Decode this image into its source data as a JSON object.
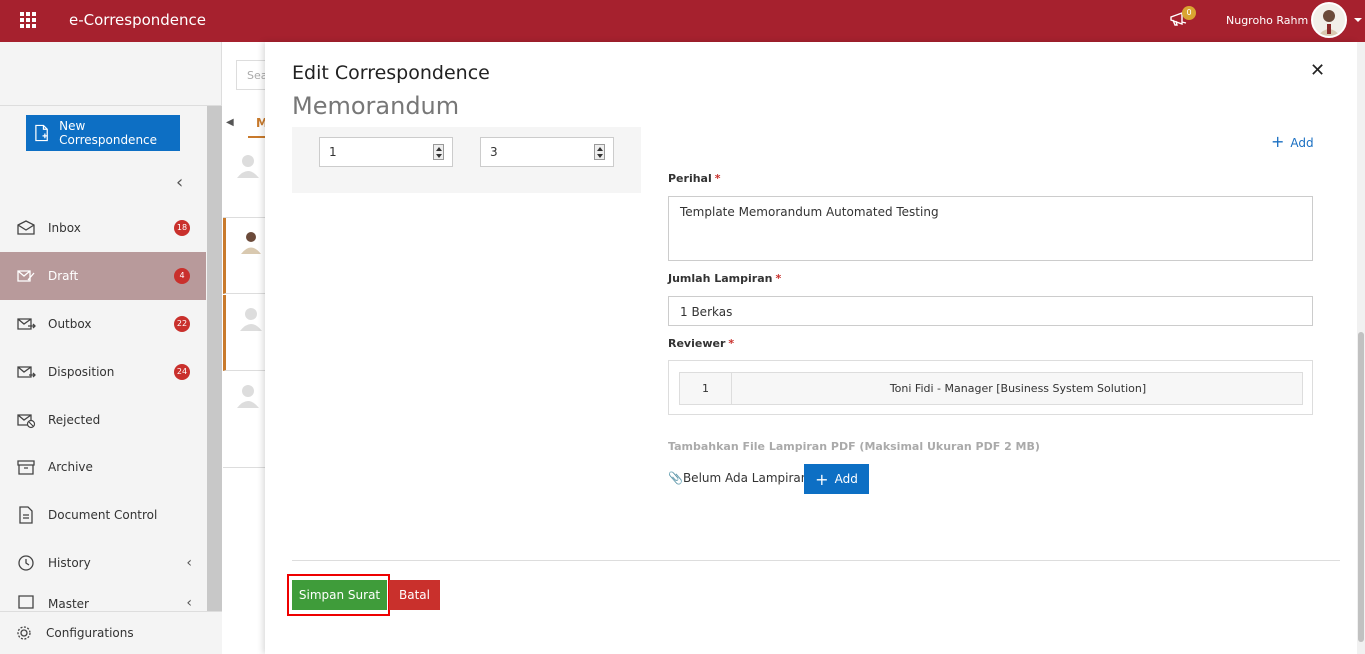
{
  "topbar": {
    "app_title": "e-Correspondence",
    "notification_count": "0",
    "user_name": "Nugroho Rahm"
  },
  "sidebar": {
    "new_button": "New Correspondence",
    "items": [
      {
        "label": "Inbox",
        "badge": "18"
      },
      {
        "label": "Draft",
        "badge": "4"
      },
      {
        "label": "Outbox",
        "badge": "22"
      },
      {
        "label": "Disposition",
        "badge": "24"
      },
      {
        "label": "Rejected"
      },
      {
        "label": "Archive"
      },
      {
        "label": "Document Control"
      },
      {
        "label": "History"
      },
      {
        "label": "Master"
      }
    ],
    "configurations": "Configurations"
  },
  "middle": {
    "search_placeholder": "Sea",
    "tab_label": "M"
  },
  "modal": {
    "title": "Edit Correspondence",
    "subtitle": "Memorandum",
    "num_input_1": "1",
    "num_input_2": "3",
    "add_link": "Add",
    "perihal_label": "Perihal",
    "perihal_value": "Template Memorandum Automated Testing",
    "lampiran_label": "Jumlah Lampiran",
    "lampiran_value": "1 Berkas",
    "reviewer_label": "Reviewer",
    "reviewer_no": "1",
    "reviewer_name": "Toni Fidi - Manager [Business System Solution]",
    "file_hint": "Tambahkan File Lampiran PDF (Maksimal Ukuran PDF 2 MB)",
    "no_attachment": "Belum Ada Lampiran -",
    "add_button": "Add",
    "save_button": "Simpan Surat",
    "cancel_button": "Batal"
  },
  "colors": {
    "topbar": "#a6212e",
    "primary": "#0d6fc4",
    "success": "#3f9c3a",
    "danger": "#c9302c"
  }
}
